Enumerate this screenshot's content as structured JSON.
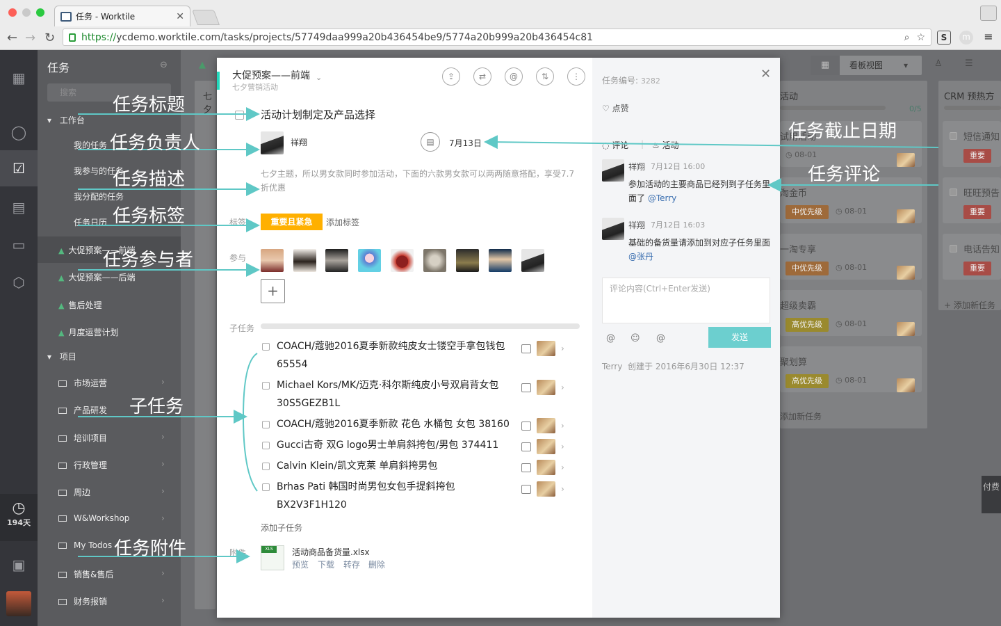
{
  "browser": {
    "tab_title": "任务 - Worktile",
    "url_https": "https://",
    "url_rest": "ycdemo.worktile.com/tasks/projects/57749daa999a20b436454be9/5774a20b999a20b436454c81"
  },
  "leftnav": {
    "days_label": "194天"
  },
  "sidebar": {
    "title": "任务",
    "search_placeholder": "搜索",
    "workbench_label": "工作台",
    "workbench_items": [
      "我的任务",
      "我参与的任务",
      "我分配的任务",
      "任务日历"
    ],
    "starred": [
      "大促预案——前端",
      "大促预案——后端",
      "售后处理",
      "月度运营计划"
    ],
    "projects_label": "项目",
    "project_items": [
      "市场运营",
      "产品研发",
      "培训项目",
      "行政管理",
      "周边",
      "W&Workshop",
      "My Todos",
      "销售&售后",
      "财务报销"
    ]
  },
  "board": {
    "view_label": "看板视图",
    "column_activity": "活动",
    "column_activity_count": "0/5",
    "column_crm": "CRM 预热方",
    "cards_mid": [
      {
        "title": "试用活动",
        "tag": "",
        "date": "08-01"
      },
      {
        "title": "淘金币",
        "tag": "中优先级",
        "date": "08-01"
      },
      {
        "title": "一淘专享",
        "tag": "中优先级",
        "date": "08-01"
      },
      {
        "title": "超级卖霸",
        "tag": "高优先级",
        "date": "08-01"
      },
      {
        "title": "聚划算",
        "tag": "高优先级",
        "date": "08-01"
      }
    ],
    "add_task_mid": "添加新任务",
    "cards_right": [
      {
        "title": "短信通知",
        "tag": "重要"
      },
      {
        "title": "旺旺预告",
        "tag": "重要"
      },
      {
        "title": "电话告知",
        "tag": "重要"
      }
    ],
    "add_task_right": "+ 添加新任务",
    "left_col_partial": "七夕",
    "side_widget": "付费"
  },
  "modal": {
    "project_name": "大促预案——前端",
    "project_sub": "七夕营销活动",
    "task_title": "活动计划制定及产品选择",
    "assignee": "祥翔",
    "due_date": "7月13日",
    "description": "七夕主题，所以男女款同时参加活动，下面的六款男女款可以两两随意搭配，享受7.7折优惠",
    "tags_label": "标签",
    "tag": "重要且紧急",
    "add_tag": "添加标签",
    "participants_label": "参与",
    "subtasks_label": "子任务",
    "subtasks": [
      "COACH/蔻驰2016夏季新款纯皮女士镂空手拿包钱包 65554",
      "Michael Kors/MK/迈克·科尔斯纯皮小号双肩背女包30S5GEZB1L",
      "COACH/蔻驰2016夏季新款 花色 水桶包 女包 38160",
      "Gucci古奇 双G logo男士单肩斜挎包/男包 374411",
      "Calvin Klein/凯文克莱 单肩斜挎男包",
      "Brhas Pati 韩国时尚男包女包手提斜挎包BX2V3F1H120"
    ],
    "add_subtask": "添加子任务",
    "attachments_label": "附件",
    "attachment": {
      "name": "活动商品备货量.xlsx",
      "badge": "XLS",
      "actions": [
        "预览",
        "下载",
        "转存",
        "删除"
      ]
    },
    "right": {
      "task_no_label": "任务编号:",
      "task_no": "3282",
      "like": "点赞",
      "tab_comments": "评论",
      "tab_activity": "活动",
      "comments": [
        {
          "author": "祥翔",
          "time": "7月12日 16:00",
          "text": "参加活动的主要商品已经列到子任务里面了 ",
          "mention": "@Terry"
        },
        {
          "author": "祥翔",
          "time": "7月12日 16:03",
          "text": "基础的备货量请添加到对应子任务里面 ",
          "mention": "@张丹"
        }
      ],
      "comment_placeholder": "评论内容(Ctrl+Enter发送)",
      "send": "发送",
      "created": "Terry  创建于 2016年6月30日 12:37"
    }
  },
  "annotations": [
    "任务标题",
    "任务负责人",
    "任务描述",
    "任务标签",
    "任务参与者",
    "子任务",
    "任务附件",
    "任务截止日期",
    "任务评论"
  ],
  "colors": {
    "accent": "#22d7bb",
    "send_button": "#6ccfcf",
    "tag": "#ffb000",
    "annotation_line": "#5fc8c6"
  }
}
